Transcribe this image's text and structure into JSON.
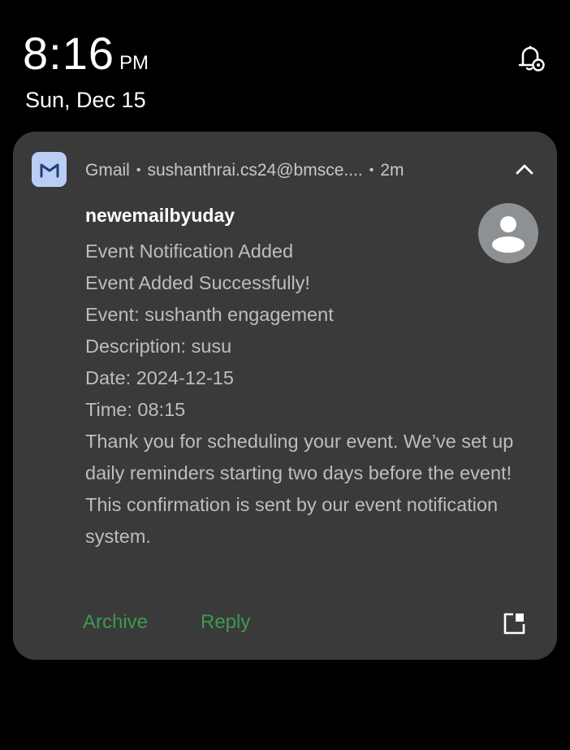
{
  "status": {
    "time": "8:16",
    "ampm": "PM",
    "date": "Sun, Dec 15"
  },
  "icons": {
    "notification_settings": "bell-settings-icon",
    "app": "gmail-icon",
    "collapse": "chevron-up-icon",
    "avatar": "person-avatar-icon",
    "expand": "open-in-window-icon"
  },
  "notification": {
    "app_name": "Gmail",
    "account": "sushanthrai.cs24@bmsce....",
    "age": "2m",
    "sender": "newemailbyuday",
    "lines": [
      "Event Notification Added",
      "Event Added Successfully!",
      "Event: sushanth engagement",
      "Description: susu",
      "Date: 2024-12-15",
      "Time: 08:15",
      "Thank you for scheduling your event. We’ve set up daily reminders starting two days before the event!",
      "This confirmation is sent by our event notification system."
    ],
    "actions": {
      "archive": "Archive",
      "reply": "Reply"
    }
  },
  "colors": {
    "background": "#000000",
    "card": "#3a3a3a",
    "action_green": "#3d9a4f",
    "gmail_icon_bg": "#b9cdf5"
  }
}
